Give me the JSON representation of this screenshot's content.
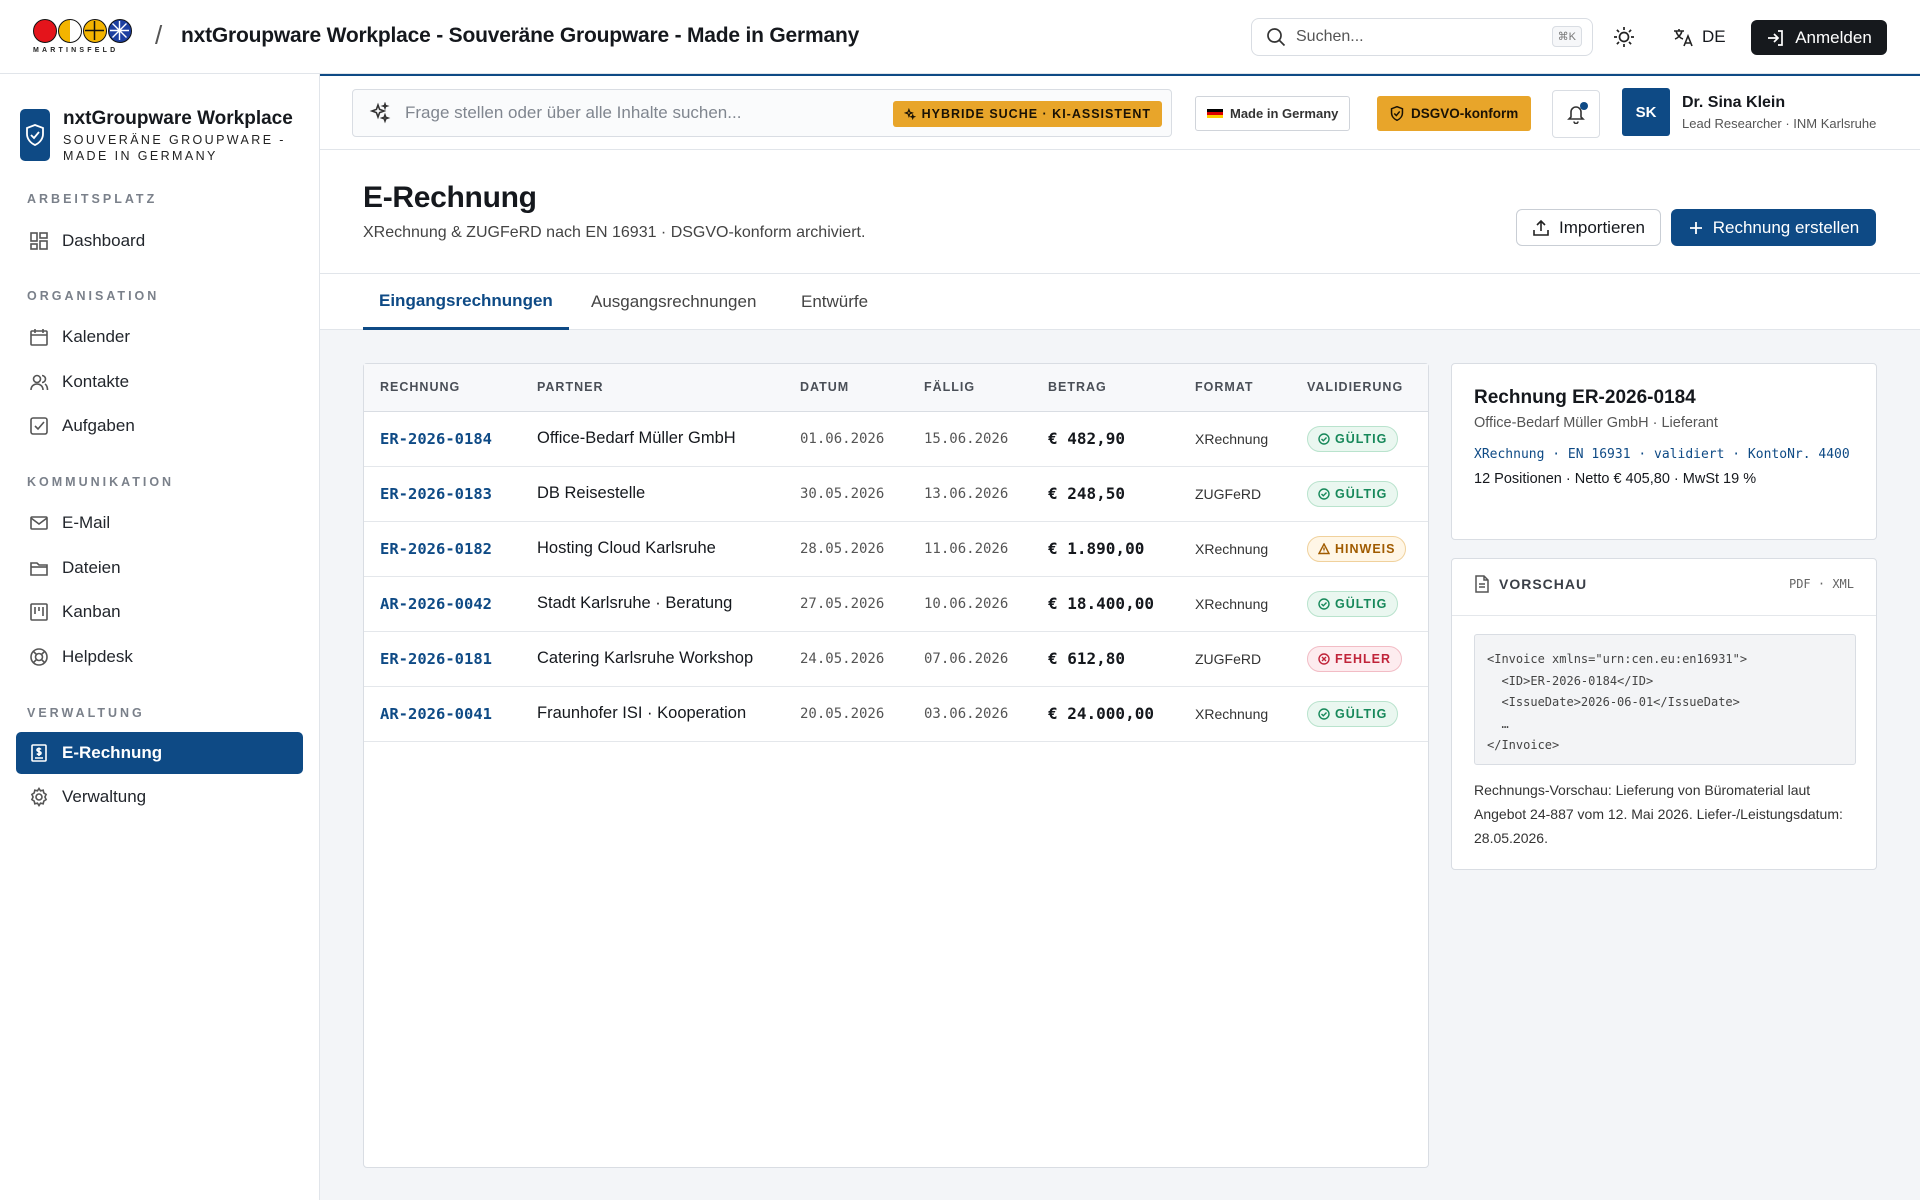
{
  "topbar": {
    "logo_text": "MARTINSFELD",
    "separator": "/",
    "title": "nxtGroupware Workplace - Souveräne Groupware - Made in Germany",
    "search_placeholder": "Suchen...",
    "search_shortcut": "⌘K",
    "language": "DE",
    "login_label": "Anmelden"
  },
  "sidebar": {
    "brand_name": "nxtGroupware Workplace",
    "brand_sub": "SOUVERÄNE GROUPWARE - MADE IN GERMANY",
    "sections": [
      {
        "title": "ARBEITSPLATZ",
        "items": [
          {
            "label": "Dashboard",
            "icon": "dashboard-icon"
          }
        ]
      },
      {
        "title": "ORGANISATION",
        "items": [
          {
            "label": "Kalender",
            "icon": "calendar-icon"
          },
          {
            "label": "Kontakte",
            "icon": "contacts-icon"
          },
          {
            "label": "Aufgaben",
            "icon": "tasks-icon"
          }
        ]
      },
      {
        "title": "KOMMUNIKATION",
        "items": [
          {
            "label": "E-Mail",
            "icon": "mail-icon"
          },
          {
            "label": "Dateien",
            "icon": "folder-icon"
          },
          {
            "label": "Kanban",
            "icon": "kanban-icon"
          },
          {
            "label": "Helpdesk",
            "icon": "helpdesk-icon"
          }
        ]
      },
      {
        "title": "VERWALTUNG",
        "items": [
          {
            "label": "E-Rechnung",
            "icon": "invoice-icon",
            "active": true
          },
          {
            "label": "Verwaltung",
            "icon": "settings-icon"
          }
        ]
      }
    ]
  },
  "subbar": {
    "ai_search_placeholder": "Frage stellen oder über alle Inhalte suchen...",
    "ai_badge": "HYBRIDE SUCHE · KI-ASSISTENT",
    "made_in": "Made in Germany",
    "dsgvo": "DSGVO-konform",
    "user": {
      "initials": "SK",
      "name": "Dr. Sina Klein",
      "role": "Lead Researcher · INM Karlsruhe"
    }
  },
  "page": {
    "title": "E-Rechnung",
    "subtitle": "XRechnung & ZUGFeRD nach EN 16931 · DSGVO-konform archiviert.",
    "import_label": "Importieren",
    "create_label": "Rechnung erstellen",
    "tabs": [
      "Eingangsrechnungen",
      "Ausgangsrechnungen",
      "Entwürfe"
    ],
    "active_tab": "Eingangsrechnungen"
  },
  "table": {
    "columns": [
      "RECHNUNG",
      "PARTNER",
      "DATUM",
      "FÄLLIG",
      "BETRAG",
      "FORMAT",
      "VALIDIERUNG"
    ],
    "rows": [
      {
        "id": "ER-2026-0184",
        "partner": "Office-Bedarf Müller GmbH",
        "date": "01.06.2026",
        "due": "15.06.2026",
        "amount": "€ 482,90",
        "format": "XRechnung",
        "status": "GÜLTIG",
        "kind": "ok"
      },
      {
        "id": "ER-2026-0183",
        "partner": "DB Reisestelle",
        "date": "30.05.2026",
        "due": "13.06.2026",
        "amount": "€ 248,50",
        "format": "ZUGFeRD",
        "status": "GÜLTIG",
        "kind": "ok"
      },
      {
        "id": "ER-2026-0182",
        "partner": "Hosting Cloud Karlsruhe",
        "date": "28.05.2026",
        "due": "11.06.2026",
        "amount": "€ 1.890,00",
        "format": "XRechnung",
        "status": "HINWEIS",
        "kind": "warn"
      },
      {
        "id": "AR-2026-0042",
        "partner": "Stadt Karlsruhe · Beratung",
        "date": "27.05.2026",
        "due": "10.06.2026",
        "amount": "€ 18.400,00",
        "format": "XRechnung",
        "status": "GÜLTIG",
        "kind": "ok"
      },
      {
        "id": "ER-2026-0181",
        "partner": "Catering Karlsruhe Workshop",
        "date": "24.05.2026",
        "due": "07.06.2026",
        "amount": "€ 612,80",
        "format": "ZUGFeRD",
        "status": "FEHLER",
        "kind": "err"
      },
      {
        "id": "AR-2026-0041",
        "partner": "Fraunhofer ISI · Kooperation",
        "date": "20.05.2026",
        "due": "03.06.2026",
        "amount": "€ 24.000,00",
        "format": "XRechnung",
        "status": "GÜLTIG",
        "kind": "ok"
      }
    ]
  },
  "detail": {
    "title": "Rechnung ER-2026-0184",
    "subtitle": "Office-Bedarf Müller GmbH · Lieferant",
    "tags": "XRechnung · EN 16931 · validiert · KontoNr. 4400",
    "info": "12 Positionen · Netto € 405,80 · MwSt 19 %"
  },
  "preview": {
    "heading": "VORSCHAU",
    "formats": "PDF · XML",
    "code": "<Invoice xmlns=\"urn:cen.eu:en16931\">\n  <ID>ER-2026-0184</ID>\n  <IssueDate>2026-06-01</IssueDate>\n  …\n</Invoice>",
    "text": "Rechnungs-Vorschau: Lieferung von Büromaterial laut Angebot 24-887 vom 12. Mai 2026. Liefer-/Leistungsdatum: 28.05.2026."
  },
  "colors": {
    "primary": "#0e4a85",
    "accent": "#e8a52a",
    "ok": "#17885a",
    "warn": "#a05b00",
    "err": "#c0243a"
  }
}
